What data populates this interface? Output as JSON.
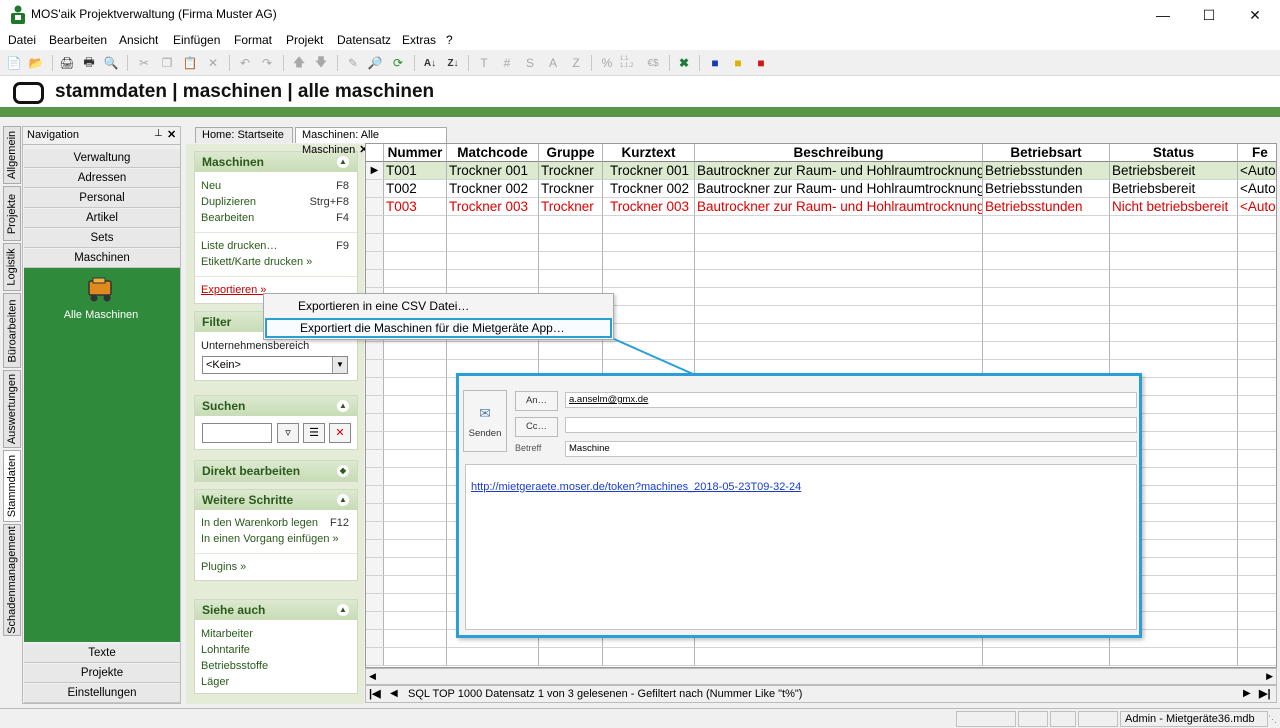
{
  "window": {
    "title": "MOS'aik Projektverwaltung (Firma Muster AG)"
  },
  "menu": [
    "Datei",
    "Bearbeiten",
    "Ansicht",
    "Einfügen",
    "Format",
    "Projekt",
    "Datensatz",
    "Extras",
    "?"
  ],
  "toolbar": {
    "text_icons": [
      "T",
      "#",
      "S",
      "A",
      "Z",
      "%",
      "1.1 1.1.2",
      "€$"
    ]
  },
  "header": {
    "title": "stammdaten | maschinen | alle maschinen"
  },
  "lefttabs": [
    "Allgemein",
    "Projekte",
    "Logistik",
    "Büroarbeiten",
    "Auswertungen",
    "Stammdaten",
    "Schadenmanagement"
  ],
  "navigation": {
    "title": "Navigation",
    "pin": "⊥",
    "close": "✕",
    "top_buttons": [
      "Verwaltung",
      "Adressen",
      "Personal",
      "Artikel",
      "Sets",
      "Maschinen"
    ],
    "bottom_buttons": [
      "Texte",
      "Projekte",
      "Einstellungen"
    ],
    "item_label": "Alle Maschinen"
  },
  "taskpane": {
    "maschinen": {
      "title": "Maschinen",
      "items": [
        {
          "label": "Neu",
          "key": "F8"
        },
        {
          "label": "Duplizieren",
          "key": "Strg+F8"
        },
        {
          "label": "Bearbeiten",
          "key": "F4"
        },
        {
          "label": "Liste drucken…",
          "key": "F9"
        },
        {
          "label": "Etikett/Karte drucken »",
          "key": ""
        },
        {
          "label": "Exportieren »",
          "key": ""
        }
      ]
    },
    "filter": {
      "title": "Filter",
      "field_label": "Unternehmensbereich",
      "select_value": "<Kein>"
    },
    "suchen": {
      "title": "Suchen",
      "input_value": ""
    },
    "direkt": {
      "title": "Direkt bearbeiten"
    },
    "weitere": {
      "title": "Weitere Schritte",
      "items": [
        {
          "label": "In den Warenkorb legen",
          "key": "F12"
        },
        {
          "label": "In einen Vorgang einfügen »",
          "key": ""
        },
        {
          "label": "Plugins »",
          "key": ""
        }
      ]
    },
    "siehe": {
      "title": "Siehe auch",
      "items": [
        "Mitarbeiter",
        "Lohntarife",
        "Betriebsstoffe",
        "Läger"
      ]
    }
  },
  "tabs": [
    "Home: Startseite",
    "Maschinen: Alle Maschinen"
  ],
  "grid": {
    "columns": [
      "Nummer",
      "Matchcode",
      "Gruppe",
      "Kurztext",
      "Beschreibung",
      "Betriebsart",
      "Status",
      "Fe"
    ],
    "rows": [
      [
        "T001",
        "Trockner 001",
        "Trockner",
        "Trockner 001",
        "Bautrockner zur Raum- und Hohlraumtrocknung",
        "Betriebsstunden",
        "Betriebsbereit",
        "<Auto"
      ],
      [
        "T002",
        "Trockner 002",
        "Trockner",
        "Trockner 002",
        "Bautrockner zur Raum- und Hohlraumtrocknung",
        "Betriebsstunden",
        "Betriebsbereit",
        "<Auto"
      ],
      [
        "T003",
        "Trockner 003",
        "Trockner",
        "Trockner 003",
        "Bautrockner zur Raum- und Hohlraumtrocknung",
        "Betriebsstunden",
        "Nicht betriebsbereit",
        "<Auto"
      ]
    ],
    "row_colors": [
      "#000000",
      "#000000",
      "#e00000"
    ],
    "selected_row_bg": "#dcebd0"
  },
  "contextmenu": {
    "items": [
      "Exportieren in eine CSV Datei…",
      "Exportiert die Maschinen für die Mietgeräte App…"
    ],
    "accent": "#2a9fd6"
  },
  "email": {
    "send_label": "Senden",
    "to_button": "An…",
    "cc_button": "Cc…",
    "subject_label": "Betreff",
    "to_value": "a.anselm@gmx.de",
    "cc_value": "",
    "subject_value": "Maschine",
    "body_link": "http://mietgeraete.moser.de/token?machines_2018-05-23T09-32-24"
  },
  "navbar": {
    "status_text": "SQL TOP 1000 Datensatz 1 von 3 gelesenen - Gefiltert nach (Nummer Like \"t%\")"
  },
  "statusbar": {
    "right_text": "Admin - Mietgeräte36.mdb"
  }
}
